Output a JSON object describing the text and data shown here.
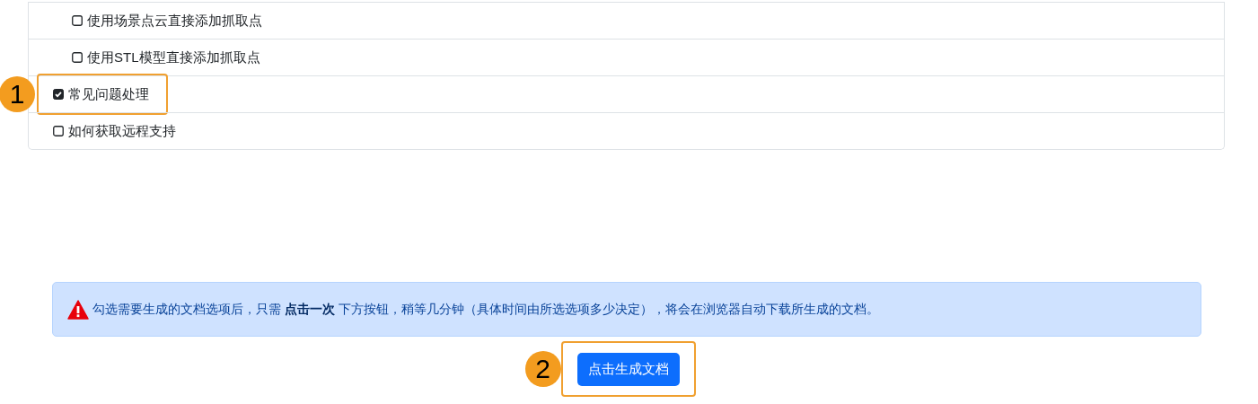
{
  "checklist": [
    {
      "children": [
        {
          "label": "使用场景点云直接添加抓取点",
          "checked": false
        },
        {
          "label": "使用STL模型直接添加抓取点",
          "checked": false
        }
      ]
    },
    {
      "label": "常见问题处理",
      "checked": true,
      "callout": "1"
    },
    {
      "label": "如何获取远程支持",
      "checked": false
    }
  ],
  "alert": {
    "text": "勾选需要生成的文档选项后，只需 **点击一次** 下方按钮，稍等几分钟（具体时间由所选选项多少决定），将会在浏览器自动下载所生成的文档。"
  },
  "generate_button": {
    "label": "点击生成文档",
    "callout": "2"
  }
}
